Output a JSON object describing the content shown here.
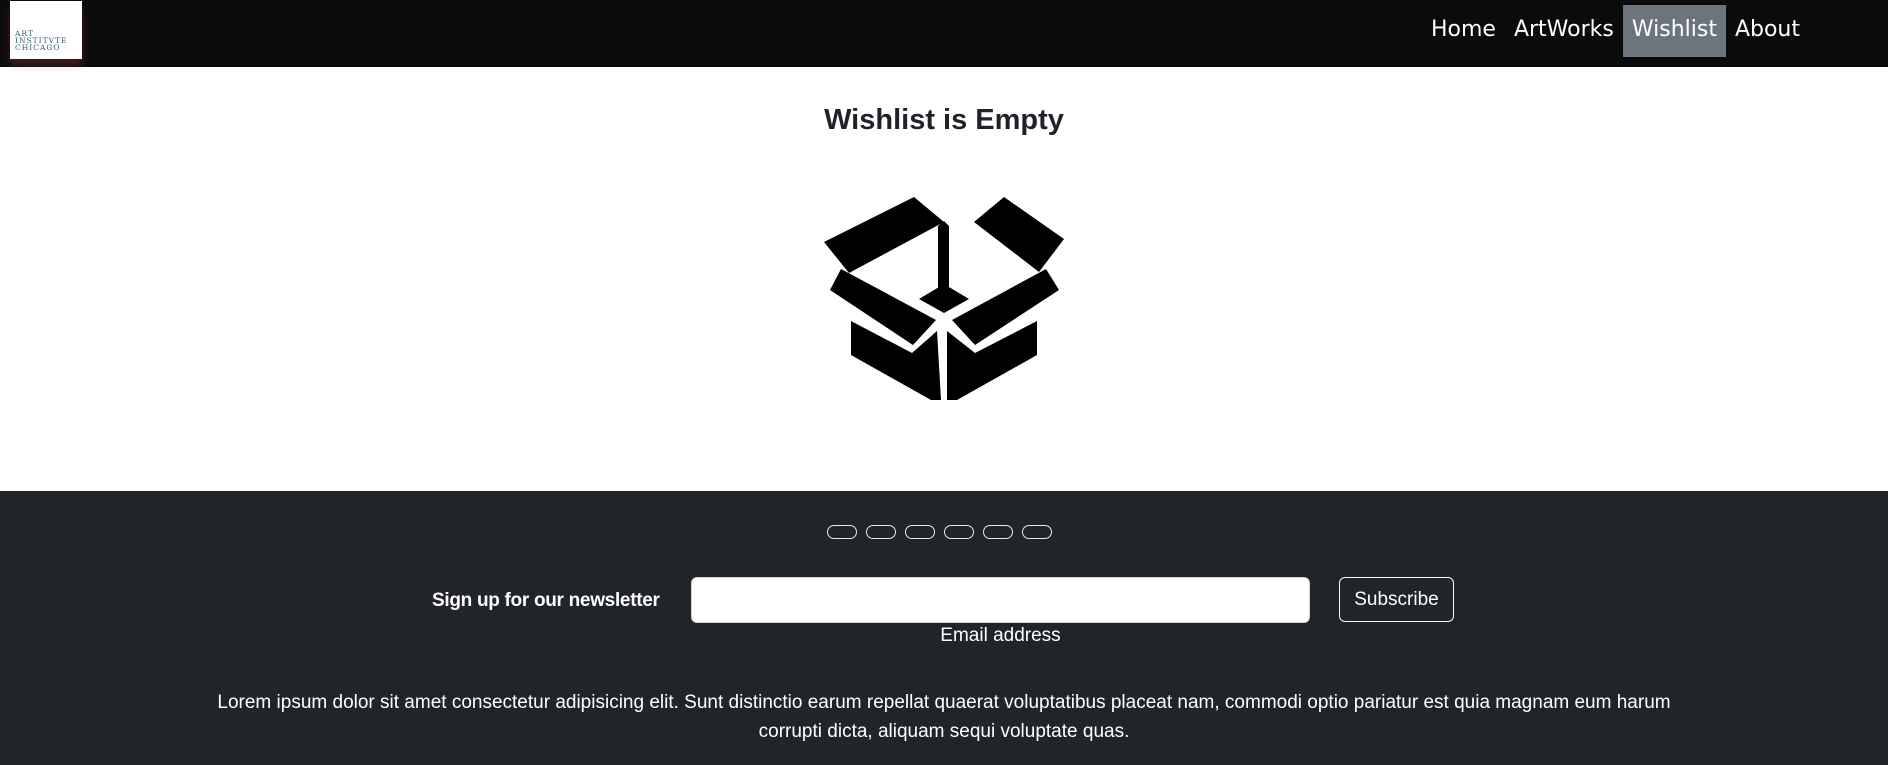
{
  "brand": {
    "logo_text": "ART\nINSTITVTE\nCHICAGO"
  },
  "nav": {
    "items": [
      {
        "label": "Home",
        "active": false
      },
      {
        "label": "ArtWorks",
        "active": false
      },
      {
        "label": "Wishlist",
        "active": true
      },
      {
        "label": "About",
        "active": false
      }
    ]
  },
  "main": {
    "title": "Wishlist is Empty",
    "empty_icon": "open-box-icon"
  },
  "footer": {
    "social_icons": [
      "social-icon-1",
      "social-icon-2",
      "social-icon-3",
      "social-icon-4",
      "social-icon-5",
      "social-icon-6"
    ],
    "newsletter_label": "Sign up for our newsletter",
    "email": {
      "value": "",
      "label": "Email address"
    },
    "subscribe_label": "Subscribe",
    "text": "Lorem ipsum dolor sit amet consectetur adipisicing elit. Sunt distinctio earum repellat quaerat voluptatibus placeat nam, commodi optio pariatur est quia magnam eum harum corrupti dicta, aliquam sequi voluptate quas."
  },
  "colors": {
    "navbar_bg": "#0b0b0c",
    "active_nav_bg": "#6c757d",
    "footer_bg": "#212529",
    "logo_text": "#2f5f6b"
  }
}
